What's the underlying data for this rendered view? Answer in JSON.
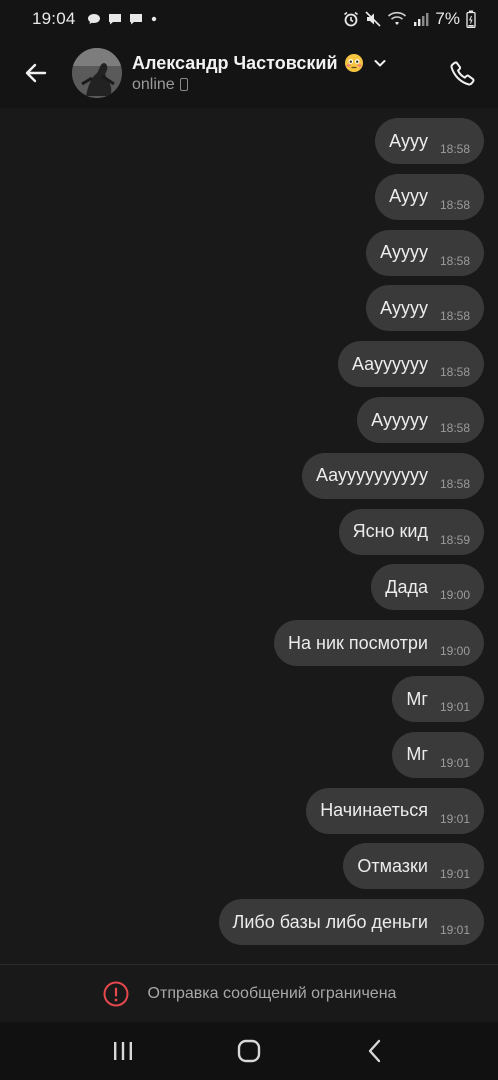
{
  "status_bar": {
    "time": "19:04",
    "battery": "7%",
    "icons_left": [
      "chat-bubble-icon",
      "message-icon",
      "message-icon",
      "dot-icon"
    ],
    "icons_right": [
      "alarm-icon",
      "mute-icon",
      "wifi-icon",
      "signal-icon",
      "battery-icon"
    ]
  },
  "header": {
    "contact_name": "Александр Частовский",
    "emoji": "flushed-face-icon",
    "status": "online",
    "back_icon": "arrow-left-icon",
    "call_icon": "phone-icon"
  },
  "messages": [
    {
      "text": "Аууу",
      "time": "18:58"
    },
    {
      "text": "Аууу",
      "time": "18:58"
    },
    {
      "text": "Ауууу",
      "time": "18:58"
    },
    {
      "text": "Ауууу",
      "time": "18:58"
    },
    {
      "text": "Аауууууу",
      "time": "18:58"
    },
    {
      "text": "Аууууу",
      "time": "18:58"
    },
    {
      "text": "Аауууууууууу",
      "time": "18:58"
    },
    {
      "text": "Ясно кид",
      "time": "18:59"
    },
    {
      "text": "Дада",
      "time": "19:00"
    },
    {
      "text": "На ник посмотри",
      "time": "19:00"
    },
    {
      "text": "Мг",
      "time": "19:01"
    },
    {
      "text": "Мг",
      "time": "19:01"
    },
    {
      "text": "Начинаеться",
      "time": "19:01"
    },
    {
      "text": "Отмазки",
      "time": "19:01"
    },
    {
      "text": "Либо базы либо деньги",
      "time": "19:01"
    }
  ],
  "restriction": {
    "text": "Отправка сообщений ограничена",
    "icon": "alert-circle-icon",
    "icon_color": "#e5484d"
  },
  "nav_bar": {
    "recent_icon": "recent-apps-icon",
    "home_icon": "home-icon",
    "back_icon": "nav-back-icon"
  },
  "colors": {
    "background": "#191919",
    "bubble": "#3a3a3a",
    "text": "#ececec",
    "muted": "#9c9c9c"
  }
}
